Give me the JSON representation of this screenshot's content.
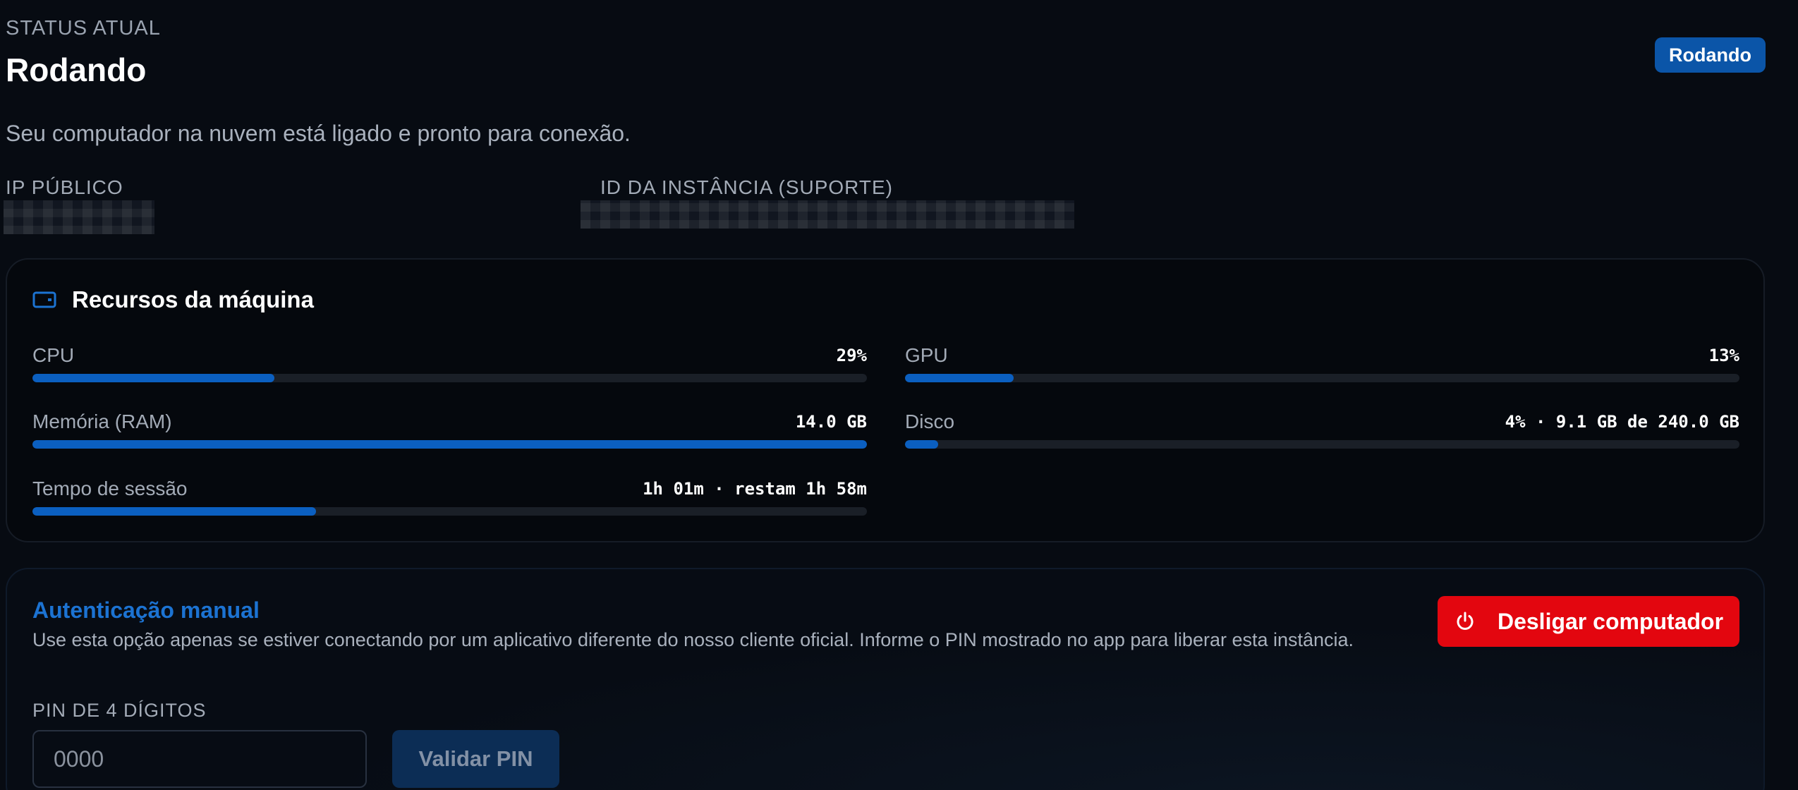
{
  "status": {
    "label": "STATUS ATUAL",
    "title": "Rodando",
    "badge": "Rodando",
    "description": "Seu computador na nuvem está ligado e pronto para conexão."
  },
  "fields": {
    "public_ip_label": "IP PÚBLICO",
    "instance_id_label": "ID DA INSTÂNCIA (SUPORTE)"
  },
  "resources": {
    "title": "Recursos da máquina",
    "icon": "drive-icon",
    "cpu": {
      "label": "CPU",
      "value": "29%",
      "fill_percent": 29
    },
    "gpu": {
      "label": "GPU",
      "value": "13%",
      "fill_percent": 13
    },
    "ram": {
      "label": "Memória (RAM)",
      "value": "14.0 GB",
      "fill_percent": 100
    },
    "disk": {
      "label": "Disco",
      "value": "4% · 9.1 GB de 240.0 GB",
      "fill_percent": 4
    },
    "session": {
      "label": "Tempo de sessão",
      "value": "1h 01m · restam 1h 58m",
      "fill_percent": 34
    }
  },
  "auth": {
    "title": "Autenticação manual",
    "description": "Use esta opção apenas se estiver conectando por um aplicativo diferente do nosso cliente oficial. Informe o PIN mostrado no app para liberar esta instância.",
    "pin_label": "PIN DE 4 DÍGITOS",
    "pin_placeholder": "0000",
    "pin_value": "",
    "validate_label": "Validar PIN",
    "shutdown_label": "Desligar computador",
    "shutdown_icon": "power-icon"
  },
  "colors": {
    "accent": "#0b5fc0",
    "danger": "#e3060f",
    "background": "#070b12"
  }
}
